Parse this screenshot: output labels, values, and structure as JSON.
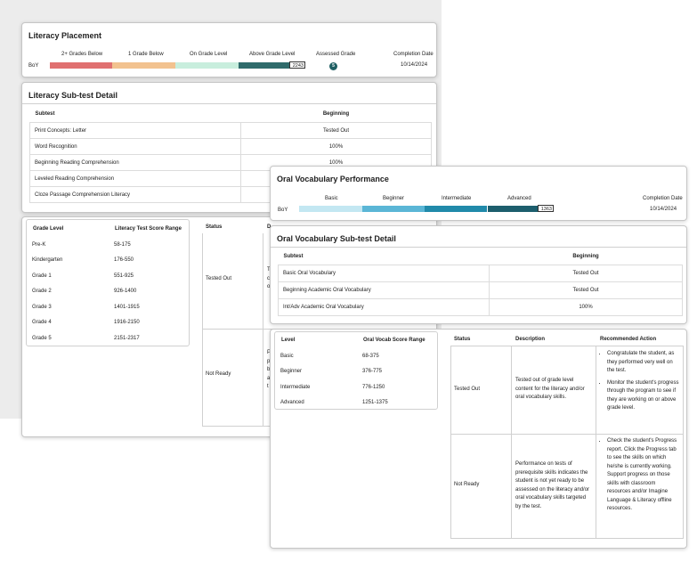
{
  "literacy_placement": {
    "title": "Literacy Placement",
    "levels": [
      "2+ Grades Below",
      "1 Grade Below",
      "On Grade Level",
      "Above Grade Level"
    ],
    "row_label": "BoY",
    "score": "2243",
    "assessed_grade_label": "Assessed Grade",
    "assessed_grade": "5",
    "completion_label": "Completion Date",
    "completion_date": "10/14/2024",
    "colors": [
      "#e07070",
      "#f2c28f",
      "#c8eedd",
      "#2f6b6b"
    ]
  },
  "literacy_subtest": {
    "title": "Literacy Sub-test Detail",
    "col_subtest": "Subtest",
    "col_beginning": "Beginning",
    "rows": [
      {
        "name": "Print Concepts: Letter",
        "value": "Tested Out"
      },
      {
        "name": "Word Recognition",
        "value": "100%"
      },
      {
        "name": "Beginning Reading Comprehension",
        "value": "100%"
      },
      {
        "name": "Leveled Reading Comprehension",
        "value": ""
      },
      {
        "name": "Cloze Passage Comprehension Literacy",
        "value": ""
      }
    ]
  },
  "literacy_ranges": {
    "col_grade": "Grade Level",
    "col_range": "Literacy Test Score Range",
    "rows": [
      {
        "grade": "Pre-K",
        "range": "58-175"
      },
      {
        "grade": "Kindergarten",
        "range": "176-550"
      },
      {
        "grade": "Grade 1",
        "range": "551-925"
      },
      {
        "grade": "Grade 2",
        "range": "926-1400"
      },
      {
        "grade": "Grade 3",
        "range": "1401-1915"
      },
      {
        "grade": "Grade 4",
        "range": "1916-2150"
      },
      {
        "grade": "Grade 5",
        "range": "2151-2317"
      }
    ],
    "status_header": "Status",
    "status_desc_partial": "D",
    "status_tested_out": "Tested Out",
    "status_not_ready": "Not Ready",
    "partial_text_1": "T c o",
    "partial_text_2": "P p b a t"
  },
  "oral_performance": {
    "title": "Oral Vocabulary  Performance",
    "levels": [
      "Basic",
      "Beginner",
      "Intermediate",
      "Advanced"
    ],
    "row_label": "BoY",
    "score": "1363",
    "completion_label": "Completion Date",
    "completion_date": "10/14/2024",
    "colors": [
      "#c3e7f2",
      "#5bb6d6",
      "#218aaa",
      "#1d5e6d"
    ]
  },
  "oral_subtest": {
    "title": "Oral Vocabulary Sub-test Detail",
    "col_subtest": "Subtest",
    "col_beginning": "Beginning",
    "rows": [
      {
        "name": "Basic Oral Vocabulary",
        "value": "Tested Out"
      },
      {
        "name": "Beginning Academic Oral Vocabulary",
        "value": "Tested Out"
      },
      {
        "name": "Int/Adv Academic Oral Vocabulary",
        "value": "100%"
      }
    ]
  },
  "oral_ranges": {
    "col_level": "Level",
    "col_range": "Oral Vocab Score Range",
    "rows": [
      {
        "level": "Basic",
        "range": "68-375"
      },
      {
        "level": "Beginner",
        "range": "376-775"
      },
      {
        "level": "Intermediate",
        "range": "776-1250"
      },
      {
        "level": "Advanced",
        "range": "1251-1375"
      }
    ]
  },
  "status_table": {
    "col_status": "Status",
    "col_description": "Description",
    "col_action": "Recommended Action",
    "rows": [
      {
        "status": "Tested Out",
        "description": "Tested out of grade level content for the literacy and/or oral vocabulary skills.",
        "actions": [
          "Congratulate the student, as they performed very well on the test.",
          "Monitor the student's progress through the program to see if they are working on or above grade level."
        ]
      },
      {
        "status": "Not Ready",
        "description": "Performance on tests of prerequisite skills indicates the student is not yet ready to be assessed on the literacy and/or oral vocabulary skills targeted by the test.",
        "actions": [
          "Check the student's Progress report. Click the Progress tab to see the skills on which he/she is currently working. Support progress on those skills with classroom resources and/or Imagine Language & Literacy offline resources."
        ]
      }
    ]
  }
}
